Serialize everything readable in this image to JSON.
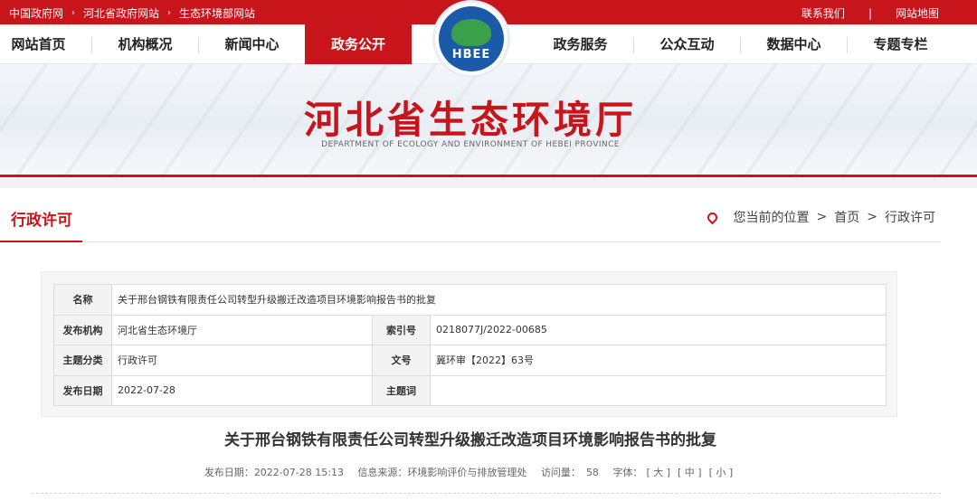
{
  "topbar": {
    "breadcrumbs": [
      "中国政府网",
      "河北省政府网站",
      "生态环境部网站"
    ],
    "crumb_sep": "›",
    "contact": "联系我们",
    "divider": "|",
    "sitemap": "网站地图"
  },
  "nav": {
    "items": [
      "网站首页",
      "机构概况",
      "新闻中心",
      "政务公开",
      "政务服务",
      "公众互动",
      "数据中心",
      "专题专栏"
    ],
    "active_index": 3
  },
  "logo": {
    "text": "HBEE"
  },
  "banner": {
    "title": "河北省生态环境厅",
    "subtitle": "DEPARTMENT OF ECOLOGY AND ENVIRONMENT OF HEBEI PROVINCE"
  },
  "section": {
    "title": "行政许可",
    "location_label": "您当前的位置",
    "path": [
      "首页",
      "行政许可"
    ],
    "path_sep": ">"
  },
  "info": {
    "name_label": "名称",
    "name_value": "关于邢台钢铁有限责任公司转型升级搬迁改造项目环境影响报告书的批复",
    "org_label": "发布机构",
    "org_value": "河北省生态环境厅",
    "index_label": "索引号",
    "index_value": "0218077J/2022-00685",
    "category_label": "主题分类",
    "category_value": "行政许可",
    "docno_label": "文号",
    "docno_value": "冀环审【2022】63号",
    "date_label": "发布日期",
    "date_value": "2022-07-28",
    "keywords_label": "主题词",
    "keywords_value": ""
  },
  "article": {
    "title": "关于邢台钢铁有限责任公司转型升级搬迁改造项目环境影响报告书的批复",
    "publish_label": "发布日期：",
    "publish_value": "2022-07-28 15:13",
    "source_label": "信息来源：",
    "source_value": "环境影响评价与排放管理处",
    "visits_label": "访问量：",
    "visits_value": "58",
    "font_label": "字体：",
    "font_large": "[ 大 ]",
    "font_medium": "[ 中 ]",
    "font_small": "[ 小 ]"
  },
  "colors": {
    "brand_red": "#c7151b",
    "logo_blue": "#1b5aa8"
  }
}
